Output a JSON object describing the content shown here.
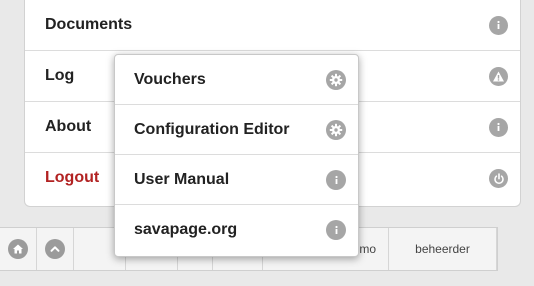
{
  "main_menu": {
    "items": [
      {
        "label": "Documents",
        "icon": "info-icon"
      },
      {
        "label": "Log",
        "icon": "warning-icon"
      },
      {
        "label": "About",
        "icon": "info-icon"
      },
      {
        "label": "Logout",
        "icon": "power-icon",
        "color": "#b22222"
      }
    ]
  },
  "popup_menu": {
    "items": [
      {
        "label": "Vouchers",
        "icon": "gear-icon"
      },
      {
        "label": "Configuration Editor",
        "icon": "gear-icon"
      },
      {
        "label": "User Manual",
        "icon": "info-icon"
      },
      {
        "label": "savapage.org",
        "icon": "info-icon"
      }
    ]
  },
  "toolbar": {
    "buttons": [
      {
        "icon": "home-icon"
      },
      {
        "icon": "chevron-up-icon"
      }
    ],
    "user_label": "demo",
    "user_label_visible": "emo",
    "role_label": "beheerder"
  },
  "colors": {
    "icon_gray": "#a6a6a6",
    "logout_red": "#b22222"
  }
}
